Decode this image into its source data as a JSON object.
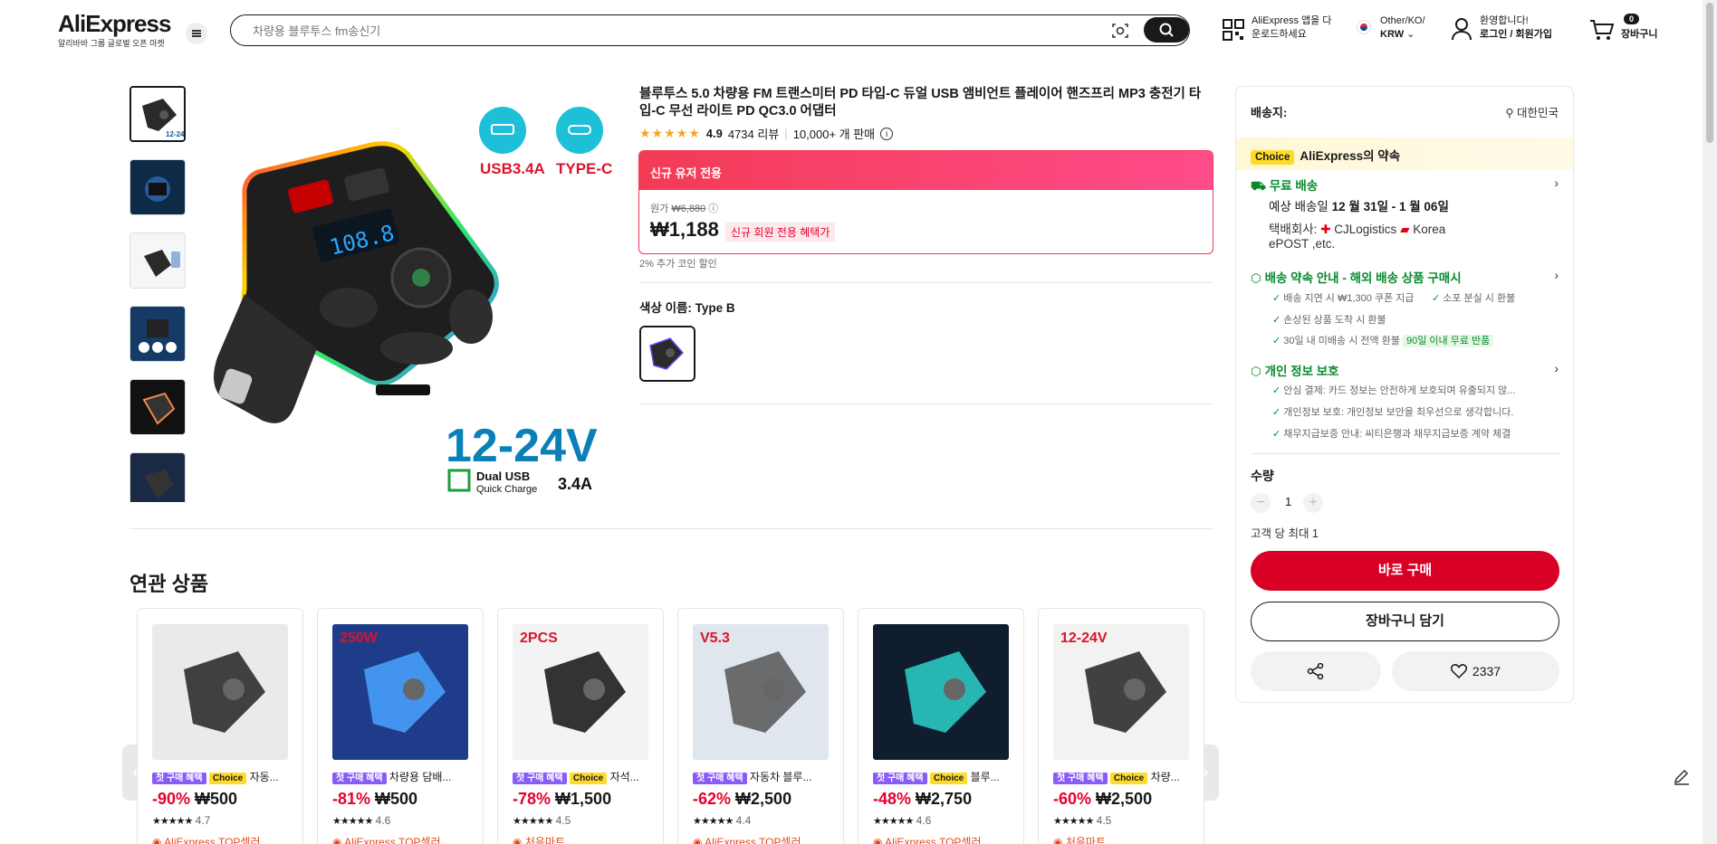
{
  "header": {
    "logo": "AliExpress",
    "logo_sub": "알리바바 그룹 글로벌 오픈 마켓",
    "search_placeholder": "차량용 블루투스 fm송신기",
    "app_line1": "AliExpress 앱을 다",
    "app_line2": "운로드하세요",
    "region_line1": "Other/KO/",
    "region_line2": "KRW",
    "account_line1": "환영합니다!",
    "account_line2": "로그인 / 회원가입",
    "cart_count": "0",
    "cart_label": "장바구니"
  },
  "product": {
    "title": "블루투스 5.0 차량용 FM 트랜스미터 PD 타입-C 듀얼 USB 앰비언트 플레이어 핸즈프리 MP3 충전기 타입-C 무선 라이트 PD QC3.0 어댑터",
    "rating": "4.9",
    "reviews": "4734 리뷰",
    "sold": "10,000+ 개 판매",
    "promo_header": "신규 유저 전용",
    "orig_label": "원가",
    "orig_price": "₩6,880",
    "price": "₩1,188",
    "price_tag": "신규 회원 전용 혜택가",
    "coin": "2% 추가 코인 할인",
    "color_label": "색상 이름: Type B",
    "img_text_usb": "USB3.4A",
    "img_text_typec": "TYPE-C",
    "img_text_volt": "12-24V",
    "img_text_dual": "Dual USB",
    "img_text_qc": "Quick Charge",
    "img_text_34": "3.4A"
  },
  "panel": {
    "ship_to": "배송지:",
    "ship_dest": "대한민국",
    "choice_badge": "Choice",
    "choice_text": "AliExpress의 약속",
    "free_ship": "무료 배송",
    "eta_prefix": "예상 배송일",
    "eta": "12 월 31일 - 1 월 06일",
    "carrier_prefix": "택배회사:",
    "carrier_1": "CJLogistics",
    "carrier_2": "Korea",
    "carrier_3": "ePOST ,etc.",
    "promise_title": "배송 약속 안내 - 해외 배송 상품 구매시",
    "promise_1": "배송 지연 시 ₩1,300 쿠폰 지급",
    "promise_2": "소포 분실 시 환불",
    "promise_3": "손상된 상품 도착 시 환불",
    "promise_4": "30일 내 미배송 시 전액 환불",
    "promise_badge": "90일 이내 무료 반품",
    "privacy_title": "개인 정보 보호",
    "privacy_1": "안심 결제: 카드 정보는 안전하게 보호되며 유출되지 않...",
    "privacy_2": "개인정보 보호: 개인정보 보안을 최우선으로 생각합니다.",
    "privacy_3": "채무지급보증 안내: 씨티은행과 채무지급보증 계약 체결",
    "qty_label": "수량",
    "qty_minus": "−",
    "qty_value": "1",
    "qty_plus": "+",
    "limit": "고객 당 최대 1",
    "buy_now": "바로 구매",
    "add_cart": "장바구니 담기",
    "wishlist_count": "2337"
  },
  "related": {
    "title": "연관 상품",
    "new_badge": "첫 구매 혜택",
    "choice_badge": "Choice",
    "items": [
      {
        "name": "자동...",
        "discount": "-90%",
        "price": "₩500",
        "rating": "4.7",
        "store": "AliExpress TOP셀러",
        "choice": true,
        "img_text": "",
        "tone": "#eaeaea",
        "tone2": "#222"
      },
      {
        "name": "차량용 담배...",
        "discount": "-81%",
        "price": "₩500",
        "rating": "4.6",
        "store": "AliExpress TOP셀러",
        "choice": false,
        "img_text": "250W",
        "tone": "#1f3c8a",
        "tone2": "#4aa3ff"
      },
      {
        "name": "자석...",
        "discount": "-78%",
        "price": "₩1,500",
        "rating": "4.5",
        "store": "처음마트",
        "choice": true,
        "img_text": "2PCS",
        "tone": "#f3f3f3",
        "tone2": "#111"
      },
      {
        "name": "자동차 블루...",
        "discount": "-62%",
        "price": "₩2,500",
        "rating": "4.4",
        "store": "AliExpress TOP셀러",
        "choice": false,
        "img_text": "V5.3",
        "tone": "#dfe6ee",
        "tone2": "#555"
      },
      {
        "name": "블루...",
        "discount": "-48%",
        "price": "₩2,750",
        "rating": "4.6",
        "store": "AliExpress TOP셀러",
        "choice": true,
        "img_text": "",
        "tone": "#0f1d2e",
        "tone2": "#2bd1c8"
      },
      {
        "name": "차량...",
        "discount": "-60%",
        "price": "₩2,500",
        "rating": "4.5",
        "store": "처음마트",
        "choice": true,
        "img_text": "12-24V",
        "tone": "#f2f2f2",
        "tone2": "#222"
      }
    ]
  }
}
